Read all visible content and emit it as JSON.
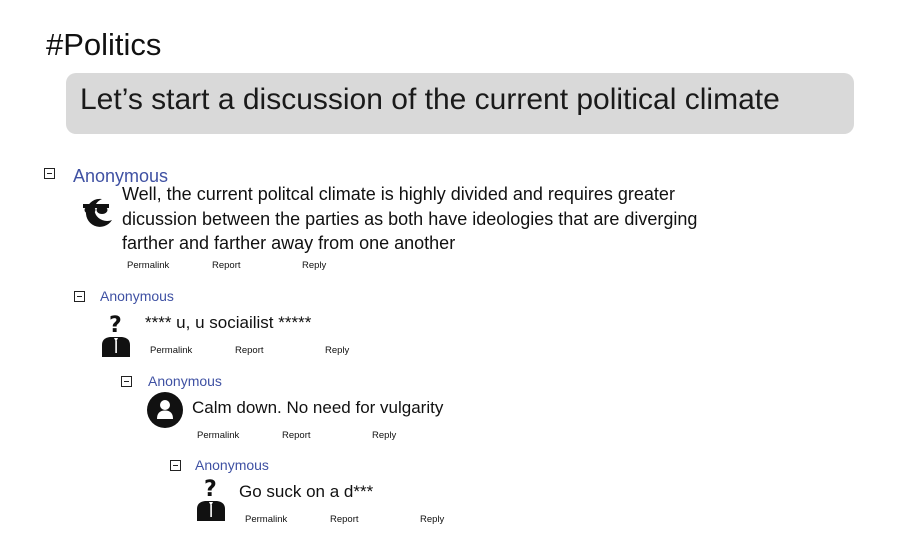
{
  "page": {
    "title": "#Politics"
  },
  "topic": {
    "text": "Let’s start a discussion of the current political climate"
  },
  "actions": {
    "permalink": "Permalink",
    "report": "Report",
    "reply": "Reply"
  },
  "comments": [
    {
      "author": "Anonymous",
      "avatar_icon": "sunglasses-icon",
      "text": "Well, the current politcal climate is highly divided and requires greater dicussion between the parties as both have ideologies that are diverging farther and farther away from one another"
    },
    {
      "author": "Anonymous",
      "avatar_icon": "question-mark-person-icon",
      "text": "**** u, u sociailist *****"
    },
    {
      "author": "Anonymous",
      "avatar_icon": "user-circle-icon",
      "text": "Calm down. No need for vulgarity"
    },
    {
      "author": "Anonymous",
      "avatar_icon": "question-mark-person-icon",
      "text": "Go suck on a d***"
    }
  ],
  "colors": {
    "author_link": "#3f51a3",
    "topic_background": "#d9d9d9",
    "text": "#111111"
  }
}
